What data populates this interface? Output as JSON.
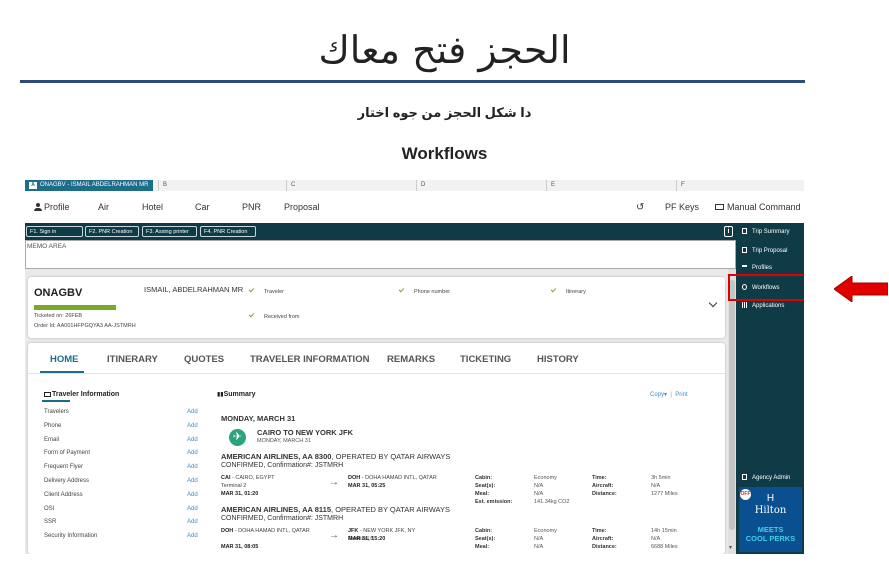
{
  "slide": {
    "title": "الحجز فتح معاك",
    "subtitle": "دا شكل الحجز من جوه اختار",
    "section_heading": "Workflows"
  },
  "app": {
    "tabs": [
      {
        "badge": "A",
        "label": "ONAGBV - ISMAIL ABDELRAHMAN MR",
        "active": true
      },
      {
        "label": "B"
      },
      {
        "label": "C"
      },
      {
        "label": "D"
      },
      {
        "label": "E"
      },
      {
        "label": "F"
      }
    ],
    "menu": {
      "items": [
        "Profile",
        "Air",
        "Hotel",
        "Car",
        "PNR",
        "Proposal"
      ],
      "pf_keys": "PF Keys",
      "manual_command": "Manual Command",
      "history_icon": "history-icon",
      "keyboard_icon": "keyboard-icon"
    },
    "function_keys": [
      "F1. Sign in",
      "F2. PNR Creation",
      "F3. Assing printer",
      "F4. PNR Creation"
    ],
    "memo_label": "MEMO AREA",
    "pnr": {
      "code": "ONAGBV",
      "progress": 1.0,
      "ticketed": "Ticketed on: 26FEB",
      "order_id": "Order Id:  AA001HFPGQYA3   AA-JSTMRH",
      "traveler_name": "ISMAIL, ABDELRAHMAN MR",
      "checks": [
        "Traveler",
        "Phone number",
        "Itinerary",
        "Received from"
      ]
    },
    "nav_tabs": [
      "HOME",
      "ITINERARY",
      "QUOTES",
      "TRAVELER INFORMATION",
      "REMARKS",
      "TICKETING",
      "HISTORY"
    ],
    "traveler_info": {
      "title": "Traveler Information",
      "add_label": "Add",
      "rows": [
        "Travelers",
        "Phone",
        "Email",
        "Form of Payment",
        "Frequent Flyer",
        "Delivery Address",
        "Client Address",
        "OSI",
        "SSR",
        "Security Information"
      ]
    },
    "summary": {
      "title": "Summary",
      "copy": "Copy▾",
      "separator": "|",
      "print": "Print",
      "date": "MONDAY, MARCH 31",
      "route": "CAIRO TO NEW YORK JFK",
      "route_date": "MONDAY, MARCH 31",
      "segments": [
        {
          "airline_bold": "AMERICAN AIRLINES, AA 8300",
          "airline_rest": ",  OPERATED BY QATAR AIRWAYS",
          "confirmation": "CONFIRMED, Confirmation#: JSTMRH",
          "dep_code": "CAI",
          "dep_name": " - CAIRO, EGYPT",
          "dep_terminal": "Terminal 2",
          "dep_time": "MAR 31, 01:20",
          "arr_code": "DOH",
          "arr_name": " - DOHA HAMAD INTL, QATAR",
          "arr_terminal": "",
          "arr_time": "MAR 31, 05:25",
          "cabin": "Economy",
          "seats": "N/A",
          "meal": "N/A",
          "emission": "141.34kg CO2",
          "time": "3h 5min",
          "aircraft": "N/A",
          "distance": "1277 Miles"
        },
        {
          "airline_bold": "AMERICAN AIRLINES, AA 8115",
          "airline_rest": ",  OPERATED BY QATAR AIRWAYS",
          "confirmation": "CONFIRMED, Confirmation#: JSTMRH",
          "dep_code": "DOH",
          "dep_name": " - DOHA HAMAD INTL, QATAR",
          "dep_terminal": "",
          "dep_time": "MAR 31, 08:05",
          "arr_code": "JFK",
          "arr_name": " - NEW YORK JFK, NY",
          "arr_terminal": "Terminal 8",
          "arr_time": "MAR 31, 15:20",
          "cabin": "Economy",
          "seats": "N/A",
          "meal": "N/A",
          "emission": "",
          "time": "14h 15min",
          "aircraft": "N/A",
          "distance": "6688 Miles"
        }
      ],
      "labels": {
        "cabin": "Cabin:",
        "seats": "Seat(s):",
        "meal": "Meal:",
        "emission": "Est. emission:",
        "time": "Time:",
        "aircraft": "Aircraft:",
        "distance": "Distance:"
      }
    },
    "sidebar": {
      "items": [
        "Trip Summary",
        "Trip Proposal",
        "Profiles",
        "Workflows",
        "Applications"
      ],
      "agency_admin": "Agency Admin",
      "banner": {
        "badge": "OFF",
        "logo": "H",
        "brand": "Hilton",
        "line1": "MEETS",
        "line2": "COOL PERKS"
      }
    }
  },
  "colors": {
    "accent": "#1b6d8a",
    "dark": "#0f3b47",
    "success": "#7aa828",
    "highlight": "#e00000"
  }
}
